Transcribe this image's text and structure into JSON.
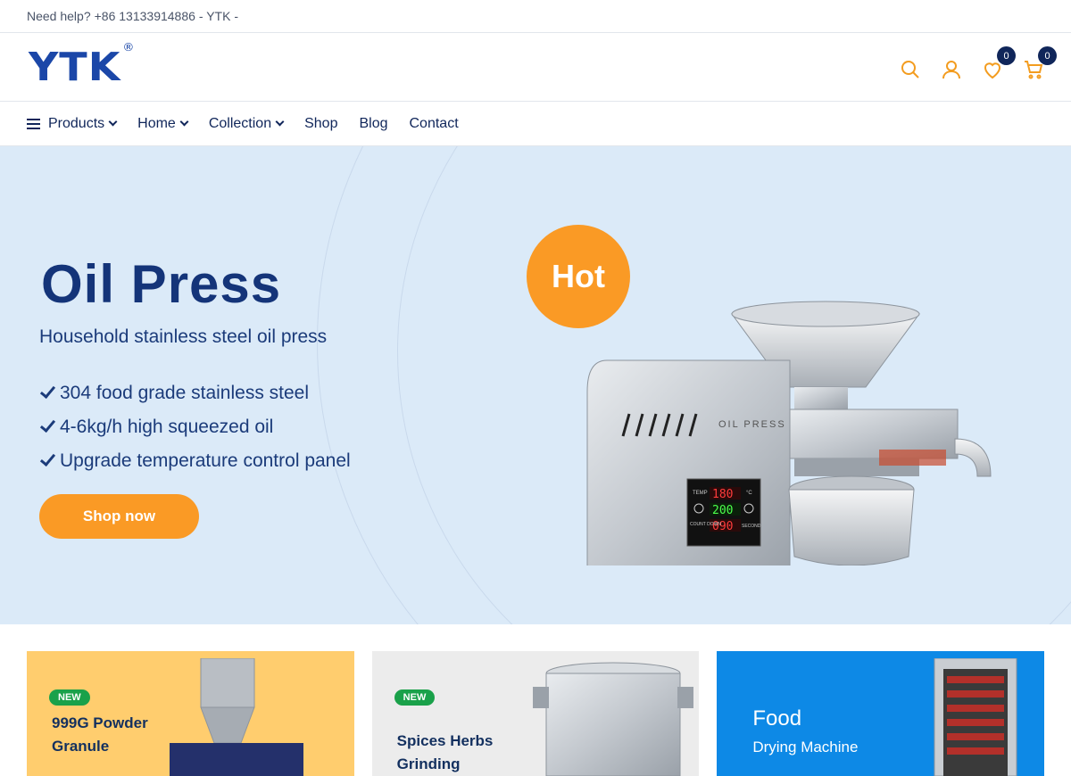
{
  "topbar": {
    "help_label": "Need help?",
    "phone": "+86 13133914886",
    "suffix": "- YTK -"
  },
  "header": {
    "logo": "YTK",
    "logo_mark": "®",
    "wishlist_count": "0",
    "cart_count": "0"
  },
  "nav": {
    "items": [
      {
        "label": "Products"
      },
      {
        "label": "Home"
      },
      {
        "label": "Collection"
      },
      {
        "label": "Shop"
      },
      {
        "label": "Blog"
      },
      {
        "label": "Contact"
      }
    ]
  },
  "hero": {
    "title": "Oil Press",
    "subtitle": "Household stainless steel oil press",
    "features": [
      "304 food grade stainless steel",
      "4-6kg/h high squeezed oil",
      "Upgrade temperature control panel"
    ],
    "button": "Shop now",
    "hot_badge": "Hot",
    "machine_label": "OIL PRESS",
    "panel_temp": "180",
    "panel_set": "200",
    "panel_count": "090",
    "panel_temp_label": "TEMP",
    "panel_count_label": "COUNT DOWN",
    "panel_second_label": "SECOND",
    "panel_unit": "°C"
  },
  "cards": [
    {
      "badge": "NEW",
      "title_line1": "999G Powder",
      "title_line2": "Granule"
    },
    {
      "badge": "NEW",
      "title_line1": "Spices Herbs",
      "title_line2": "Grinding"
    },
    {
      "title_line1": "Food",
      "title_line2": "Drying Machine"
    }
  ],
  "colors": {
    "brand_blue": "#1b47a8",
    "navy": "#10265a",
    "accent_orange": "#fa9a25",
    "hero_bg": "#dbeaf8",
    "new_green": "#1aa14a"
  }
}
